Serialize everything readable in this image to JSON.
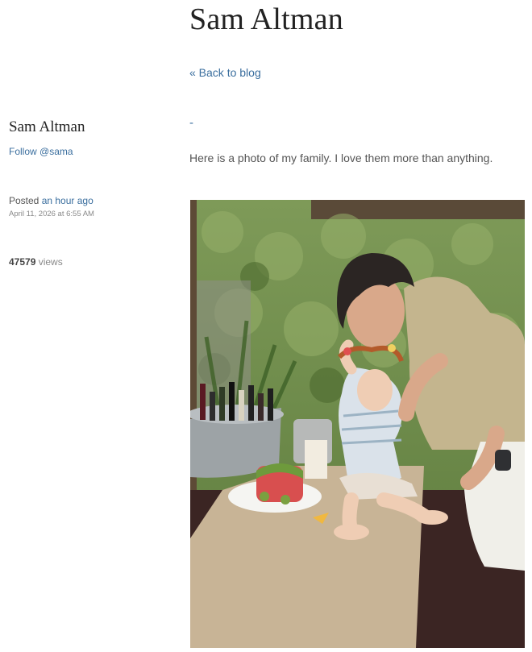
{
  "header": {
    "title": "Sam Altman",
    "back_label": "« Back to blog"
  },
  "sidebar": {
    "author_name": "Sam Altman",
    "follow_label": "Follow @sama",
    "posted_prefix": "Posted",
    "posted_relative": "an hour ago",
    "posted_date": "April 11, 2026 at 6:55 AM",
    "views_count": "47579",
    "views_label": "views"
  },
  "post": {
    "title": "-",
    "body": "Here is a photo of my family. I love them more than anything."
  },
  "colors": {
    "link": "#3a6e9e",
    "title": "#222222",
    "muted": "#8a8a8a"
  }
}
